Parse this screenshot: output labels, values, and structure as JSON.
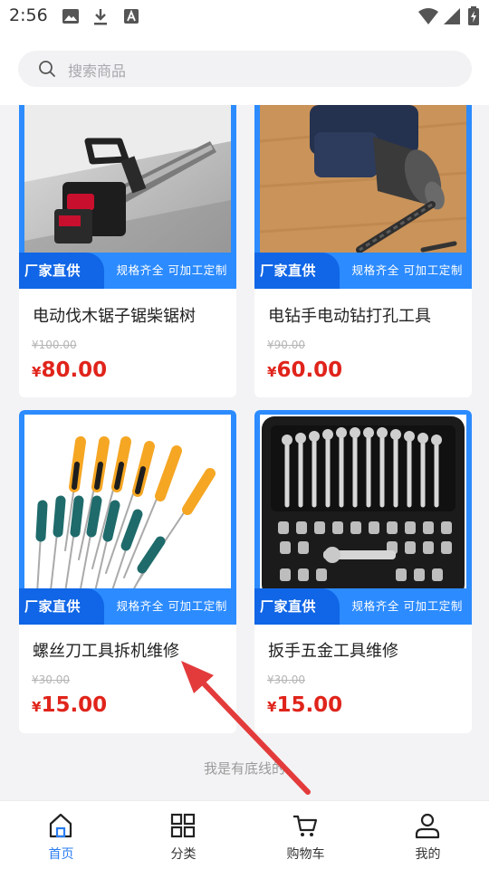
{
  "status_bar": {
    "time": "2:56"
  },
  "search": {
    "placeholder": "搜索商品"
  },
  "banner": {
    "tag": "厂家直供",
    "text": "规格齐全 可加工定制"
  },
  "products": [
    {
      "title": "电动伐木锯子锯柴锯树",
      "original_price": "¥100.00",
      "currency": "¥",
      "price": "80.00",
      "image": "chainsaw"
    },
    {
      "title": "电钻手电动钻打孔工具",
      "original_price": "¥90.00",
      "currency": "¥",
      "price": "60.00",
      "image": "power-drill"
    },
    {
      "title": "螺丝刀工具拆机维修",
      "original_price": "¥30.00",
      "currency": "¥",
      "price": "15.00",
      "image": "screwdriver-set"
    },
    {
      "title": "扳手五金工具维修",
      "original_price": "¥30.00",
      "currency": "¥",
      "price": "15.00",
      "image": "wrench-socket-set"
    }
  ],
  "footer_note": "我是有底线的",
  "tabbar": {
    "items": [
      {
        "label": "首页",
        "icon": "home-icon",
        "active": true
      },
      {
        "label": "分类",
        "icon": "grid-icon",
        "active": false
      },
      {
        "label": "购物车",
        "icon": "cart-icon",
        "active": false
      },
      {
        "label": "我的",
        "icon": "user-icon",
        "active": false
      }
    ]
  },
  "colors": {
    "accent": "#2a7cf2",
    "banner": "#2c8bff",
    "banner_tag": "#1066e6",
    "price": "#e0241b",
    "arrow": "#e33b3b"
  }
}
